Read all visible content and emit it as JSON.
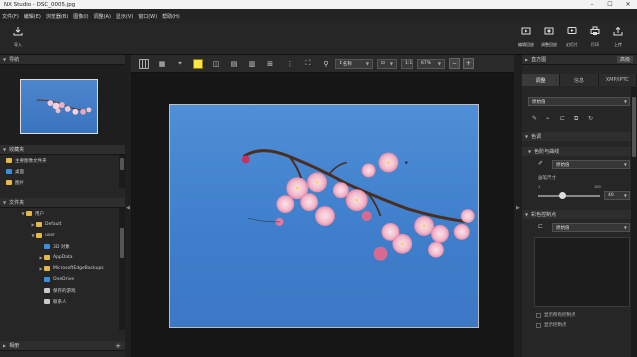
{
  "window": {
    "app_name": "NX Studio",
    "file_name": "DSC_0005.jpg",
    "min_glyph": "–",
    "max_glyph": "☐",
    "close_glyph": "✕"
  },
  "menus": [
    "文件(F)",
    "编辑(E)",
    "浏览器(B)",
    "图像(I)",
    "调整(A)",
    "显示(V)",
    "窗口(W)",
    "帮助(H)"
  ],
  "ribbon": {
    "import_label": "导入",
    "right_buttons": [
      {
        "label": "编辑回放",
        "icon": "play-edit-icon"
      },
      {
        "label": "调整回放",
        "icon": "play-adjust-icon"
      },
      {
        "label": "幻灯片",
        "icon": "slideshow-icon"
      },
      {
        "label": "打印",
        "icon": "print-icon"
      },
      {
        "label": "上传",
        "icon": "upload-icon"
      }
    ]
  },
  "left_panel": {
    "navigation_title": "导航",
    "favorites_title": "收藏夹",
    "favorites_items": [
      "主要图像文件夹",
      "桌面",
      "图片"
    ],
    "folders_title": "文件夹",
    "tree": [
      {
        "label": "用户",
        "level": 1,
        "icon": "folder"
      },
      {
        "label": "Default",
        "level": 2,
        "icon": "folder"
      },
      {
        "label": "user",
        "level": 2,
        "icon": "folder"
      },
      {
        "label": "3D 对象",
        "level": 3,
        "icon": "folder-blue"
      },
      {
        "label": "AppData",
        "level": 3,
        "icon": "folder"
      },
      {
        "label": "MicrosoftEdgeBackups",
        "level": 3,
        "icon": "folder"
      },
      {
        "label": "OneDrive",
        "level": 3,
        "icon": "folder-blue"
      },
      {
        "label": "保存的游戏",
        "level": 3,
        "icon": "folder-dark"
      },
      {
        "label": "联系人",
        "level": 3,
        "icon": "folder-dark"
      }
    ],
    "bottom_title": "相册",
    "bottom_plus": "+"
  },
  "view_toolbar": {
    "sort_label": "名称",
    "zoom_value": "67%",
    "fit_label": "1:1"
  },
  "right_panel": {
    "panel_title": "直方图",
    "panel_menu": "高级",
    "tabs": [
      "调整",
      "信息",
      "XMP/IPTC"
    ],
    "preset_value": "原始值",
    "tone_section": "色调",
    "levels_section": "色阶与曲线",
    "levels_preset": "原始值",
    "brush_label": "画笔尺寸",
    "slider_min": "1",
    "slider_max": "100",
    "slider_value": "40",
    "slider_fraction": 0.4,
    "color_section": "彩色控制点",
    "color_preset": "原始值",
    "checkbox1": "显示所有控制点",
    "checkbox2": "显示控制点"
  },
  "grips": {
    "left_arrow": "◀",
    "right_arrow": "▶"
  }
}
